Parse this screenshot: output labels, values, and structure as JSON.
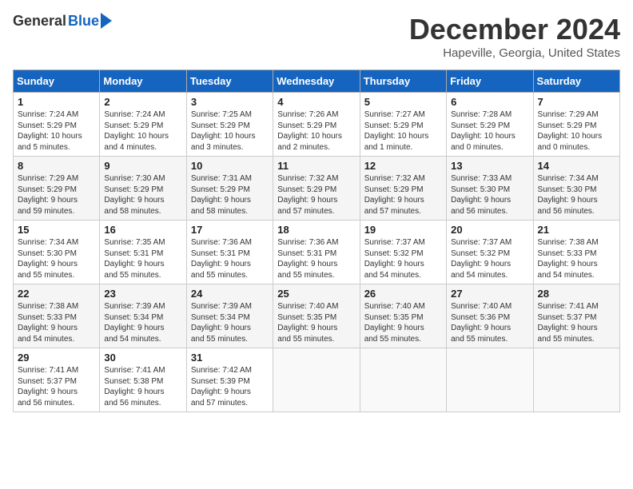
{
  "header": {
    "logo_general": "General",
    "logo_blue": "Blue",
    "month": "December 2024",
    "location": "Hapeville, Georgia, United States"
  },
  "days_of_week": [
    "Sunday",
    "Monday",
    "Tuesday",
    "Wednesday",
    "Thursday",
    "Friday",
    "Saturday"
  ],
  "weeks": [
    [
      {
        "day": "1",
        "info": "Sunrise: 7:24 AM\nSunset: 5:29 PM\nDaylight: 10 hours\nand 5 minutes."
      },
      {
        "day": "2",
        "info": "Sunrise: 7:24 AM\nSunset: 5:29 PM\nDaylight: 10 hours\nand 4 minutes."
      },
      {
        "day": "3",
        "info": "Sunrise: 7:25 AM\nSunset: 5:29 PM\nDaylight: 10 hours\nand 3 minutes."
      },
      {
        "day": "4",
        "info": "Sunrise: 7:26 AM\nSunset: 5:29 PM\nDaylight: 10 hours\nand 2 minutes."
      },
      {
        "day": "5",
        "info": "Sunrise: 7:27 AM\nSunset: 5:29 PM\nDaylight: 10 hours\nand 1 minute."
      },
      {
        "day": "6",
        "info": "Sunrise: 7:28 AM\nSunset: 5:29 PM\nDaylight: 10 hours\nand 0 minutes."
      },
      {
        "day": "7",
        "info": "Sunrise: 7:29 AM\nSunset: 5:29 PM\nDaylight: 10 hours\nand 0 minutes."
      }
    ],
    [
      {
        "day": "8",
        "info": "Sunrise: 7:29 AM\nSunset: 5:29 PM\nDaylight: 9 hours\nand 59 minutes."
      },
      {
        "day": "9",
        "info": "Sunrise: 7:30 AM\nSunset: 5:29 PM\nDaylight: 9 hours\nand 58 minutes."
      },
      {
        "day": "10",
        "info": "Sunrise: 7:31 AM\nSunset: 5:29 PM\nDaylight: 9 hours\nand 58 minutes."
      },
      {
        "day": "11",
        "info": "Sunrise: 7:32 AM\nSunset: 5:29 PM\nDaylight: 9 hours\nand 57 minutes."
      },
      {
        "day": "12",
        "info": "Sunrise: 7:32 AM\nSunset: 5:29 PM\nDaylight: 9 hours\nand 57 minutes."
      },
      {
        "day": "13",
        "info": "Sunrise: 7:33 AM\nSunset: 5:30 PM\nDaylight: 9 hours\nand 56 minutes."
      },
      {
        "day": "14",
        "info": "Sunrise: 7:34 AM\nSunset: 5:30 PM\nDaylight: 9 hours\nand 56 minutes."
      }
    ],
    [
      {
        "day": "15",
        "info": "Sunrise: 7:34 AM\nSunset: 5:30 PM\nDaylight: 9 hours\nand 55 minutes."
      },
      {
        "day": "16",
        "info": "Sunrise: 7:35 AM\nSunset: 5:31 PM\nDaylight: 9 hours\nand 55 minutes."
      },
      {
        "day": "17",
        "info": "Sunrise: 7:36 AM\nSunset: 5:31 PM\nDaylight: 9 hours\nand 55 minutes."
      },
      {
        "day": "18",
        "info": "Sunrise: 7:36 AM\nSunset: 5:31 PM\nDaylight: 9 hours\nand 55 minutes."
      },
      {
        "day": "19",
        "info": "Sunrise: 7:37 AM\nSunset: 5:32 PM\nDaylight: 9 hours\nand 54 minutes."
      },
      {
        "day": "20",
        "info": "Sunrise: 7:37 AM\nSunset: 5:32 PM\nDaylight: 9 hours\nand 54 minutes."
      },
      {
        "day": "21",
        "info": "Sunrise: 7:38 AM\nSunset: 5:33 PM\nDaylight: 9 hours\nand 54 minutes."
      }
    ],
    [
      {
        "day": "22",
        "info": "Sunrise: 7:38 AM\nSunset: 5:33 PM\nDaylight: 9 hours\nand 54 minutes."
      },
      {
        "day": "23",
        "info": "Sunrise: 7:39 AM\nSunset: 5:34 PM\nDaylight: 9 hours\nand 54 minutes."
      },
      {
        "day": "24",
        "info": "Sunrise: 7:39 AM\nSunset: 5:34 PM\nDaylight: 9 hours\nand 55 minutes."
      },
      {
        "day": "25",
        "info": "Sunrise: 7:40 AM\nSunset: 5:35 PM\nDaylight: 9 hours\nand 55 minutes."
      },
      {
        "day": "26",
        "info": "Sunrise: 7:40 AM\nSunset: 5:35 PM\nDaylight: 9 hours\nand 55 minutes."
      },
      {
        "day": "27",
        "info": "Sunrise: 7:40 AM\nSunset: 5:36 PM\nDaylight: 9 hours\nand 55 minutes."
      },
      {
        "day": "28",
        "info": "Sunrise: 7:41 AM\nSunset: 5:37 PM\nDaylight: 9 hours\nand 55 minutes."
      }
    ],
    [
      {
        "day": "29",
        "info": "Sunrise: 7:41 AM\nSunset: 5:37 PM\nDaylight: 9 hours\nand 56 minutes."
      },
      {
        "day": "30",
        "info": "Sunrise: 7:41 AM\nSunset: 5:38 PM\nDaylight: 9 hours\nand 56 minutes."
      },
      {
        "day": "31",
        "info": "Sunrise: 7:42 AM\nSunset: 5:39 PM\nDaylight: 9 hours\nand 57 minutes."
      },
      {
        "day": "",
        "info": ""
      },
      {
        "day": "",
        "info": ""
      },
      {
        "day": "",
        "info": ""
      },
      {
        "day": "",
        "info": ""
      }
    ]
  ]
}
